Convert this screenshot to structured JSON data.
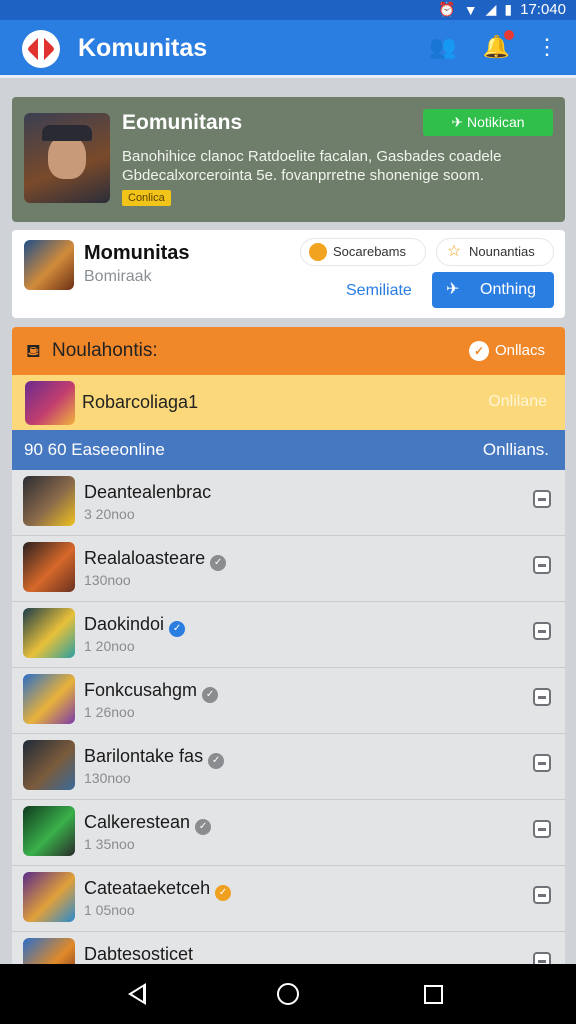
{
  "status": {
    "time": "17:040"
  },
  "appbar": {
    "title": "Komunitas",
    "icons": [
      "community-icon",
      "notification-icon",
      "more-vert-icon"
    ]
  },
  "hero": {
    "title": "Eomunitans",
    "button": "Notikican",
    "description": "Banohihice clanoc Ratdoelite facalan, Gasbades coadele Gbdecalxorcerointa 5e. fovanprretne shonenige soom.",
    "tag": "Conlica"
  },
  "card": {
    "title": "Momunitas",
    "subtitle": "Bomiraak",
    "pill1": "Socarebams",
    "pill2": "Nounantias",
    "link": "Semiliate",
    "button": "Onthing"
  },
  "section": {
    "title": "Noulahontis:",
    "right": "Onllacs"
  },
  "featured": {
    "title": "Robarcoliaga1",
    "right": "Onlilane"
  },
  "bluebar": {
    "left": "90 60  Easeeonline",
    "right": "Onllians."
  },
  "rows": [
    {
      "name": "Deantealenbrac",
      "sub": "3 20noo",
      "badge": "",
      "icon_colors": [
        "#2c2c33",
        "#8a6a4a",
        "#f0c21f"
      ]
    },
    {
      "name": "Realaloasteare",
      "sub": "130noo",
      "badge": "gray",
      "icon_colors": [
        "#2a2020",
        "#d6682a",
        "#6a3020"
      ]
    },
    {
      "name": "Daokindoi",
      "sub": "1 20noo",
      "badge": "blue",
      "icon_colors": [
        "#1b3b4a",
        "#e8c03a",
        "#2aa0a0"
      ]
    },
    {
      "name": "Fonkcusahgm",
      "sub": "1 26noo",
      "badge": "gray",
      "icon_colors": [
        "#2a6ec8",
        "#e9b23a",
        "#7a3aa8"
      ]
    },
    {
      "name": "Barilontake fas",
      "sub": "130noo",
      "badge": "gray",
      "icon_colors": [
        "#1f2a3a",
        "#7a5a3a",
        "#3a6a9a"
      ]
    },
    {
      "name": "Calkerestean",
      "sub": "1 35noo",
      "badge": "gray",
      "icon_colors": [
        "#0f3a1f",
        "#3ab04a",
        "#2a2a2a"
      ]
    },
    {
      "name": "Cateataeketceh",
      "sub": "1 05noo",
      "badge": "orange",
      "icon_colors": [
        "#5a2a8a",
        "#e0a03a",
        "#2a8ad0"
      ]
    },
    {
      "name": "Dabtesosticet",
      "sub": "",
      "badge": "",
      "icon_colors": [
        "#2a6ec8",
        "#e08a2a",
        "#6a2a1a"
      ]
    }
  ],
  "colors": {
    "primary": "#2a7de1",
    "accent_orange": "#f0882a",
    "featured_yellow": "#fbd97a",
    "green": "#2fbf4a"
  }
}
